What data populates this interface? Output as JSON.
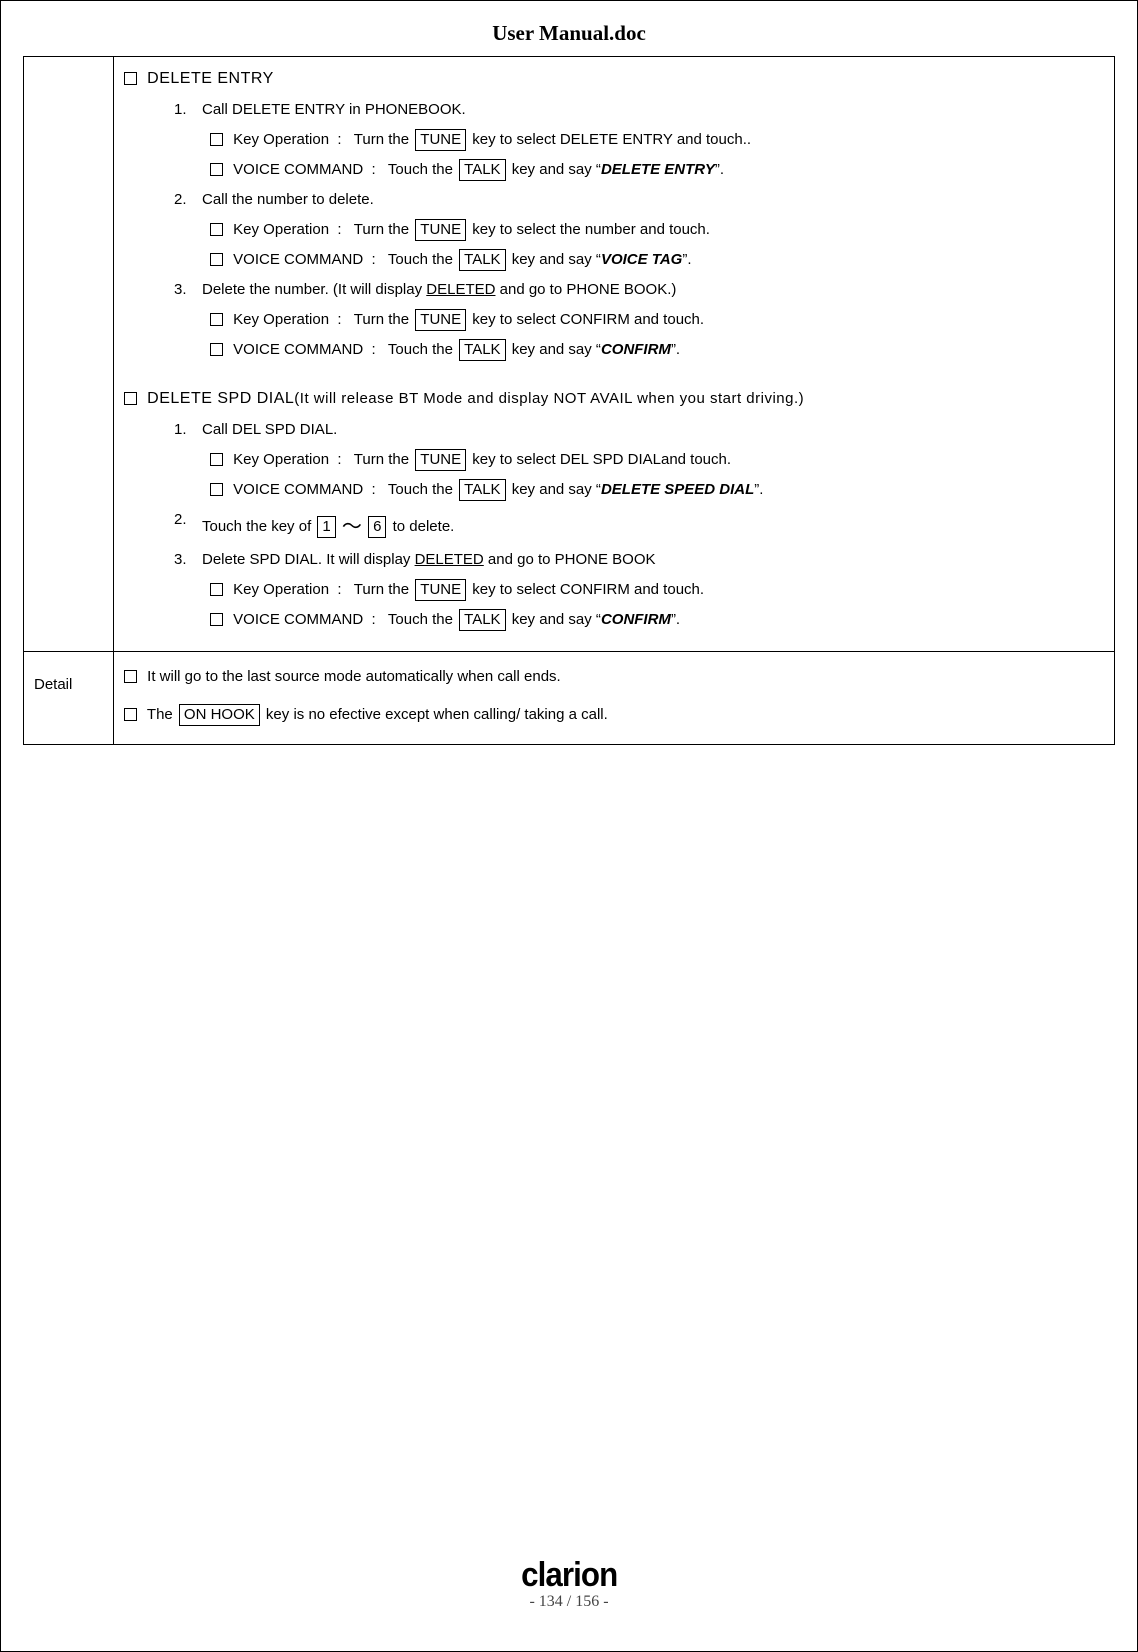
{
  "doc_title": "User Manual.doc",
  "main": {
    "section1": {
      "heading": "DELETE ENTRY",
      "step1": {
        "num": "1.",
        "text": "Call DELETE ENTRY in PHONEBOOK.",
        "keyop_label": "Key Operation",
        "keyop_pre": "Turn the ",
        "keyop_key": "TUNE",
        "keyop_post": " key to select DELETE ENTRY and touch..",
        "vc_label": "VOICE COMMAND",
        "vc_pre": "Touch the ",
        "vc_key": "TALK",
        "vc_mid": " key and say “",
        "vc_cmd": "DELETE ENTRY",
        "vc_end": "”."
      },
      "step2": {
        "num": "2.",
        "text": "Call the number to delete.",
        "keyop_label": "Key Operation",
        "keyop_pre": "Turn the ",
        "keyop_key": "TUNE",
        "keyop_post": " key to select the number and touch.",
        "vc_label": "VOICE COMMAND",
        "vc_pre": "Touch the ",
        "vc_key": "TALK",
        "vc_mid": " key and say “",
        "vc_cmd": "VOICE TAG",
        "vc_end": "”."
      },
      "step3": {
        "num": "3.",
        "text_pre": "Delete the number.  (It will display ",
        "text_u": "DELETED",
        "text_post": " and go to PHONE BOOK.)",
        "keyop_label": "Key Operation",
        "keyop_pre": "Turn the ",
        "keyop_key": "TUNE",
        "keyop_post": " key to select CONFIRM and touch.",
        "vc_label": "VOICE COMMAND",
        "vc_pre": "Touch the ",
        "vc_key": "TALK",
        "vc_mid": " key and say “",
        "vc_cmd": "CONFIRM",
        "vc_end": "”."
      }
    },
    "section2": {
      "heading_pre": "DELETE SPD DIAL",
      "heading_post": "(It will release BT Mode and display NOT AVAIL when you start driving.)",
      "step1": {
        "num": "1.",
        "text": "Call DEL SPD DIAL.",
        "keyop_label": "Key Operation",
        "keyop_pre": "Turn the ",
        "keyop_key": "TUNE",
        "keyop_post": " key to select DEL SPD DIALand touch.",
        "vc_label": "VOICE COMMAND",
        "vc_pre": "Touch the ",
        "vc_key": "TALK",
        "vc_mid": " key and say “",
        "vc_cmd": "DELETE SPEED DIAL",
        "vc_end": "”."
      },
      "step2": {
        "num": "2.",
        "text_pre": "Touch the key of ",
        "key_from": "1",
        "tilde": "～",
        "key_to": "6",
        "text_post": " to delete."
      },
      "step3": {
        "num": "3.",
        "text_pre": "Delete SPD DIAL. It will display ",
        "text_u": "DELETED",
        "text_post": " and go to PHONE BOOK",
        "keyop_label": "Key Operation",
        "keyop_pre": "Turn the ",
        "keyop_key": "TUNE",
        "keyop_post": " key to select CONFIRM and touch.",
        "vc_label": "VOICE COMMAND",
        "vc_pre": "Touch the ",
        "vc_key": "TALK",
        "vc_mid": " key and say “",
        "vc_cmd": "CONFIRM",
        "vc_end": "”."
      }
    }
  },
  "detail": {
    "label": "Detail",
    "line1": "It will go to the last source mode automatically when call ends.",
    "line2_pre": "The ",
    "line2_key": "ON HOOK",
    "line2_post": " key is no efective except when calling/ taking a call."
  },
  "footer": {
    "brand": "clarion",
    "page": "- 134 / 156 -"
  }
}
